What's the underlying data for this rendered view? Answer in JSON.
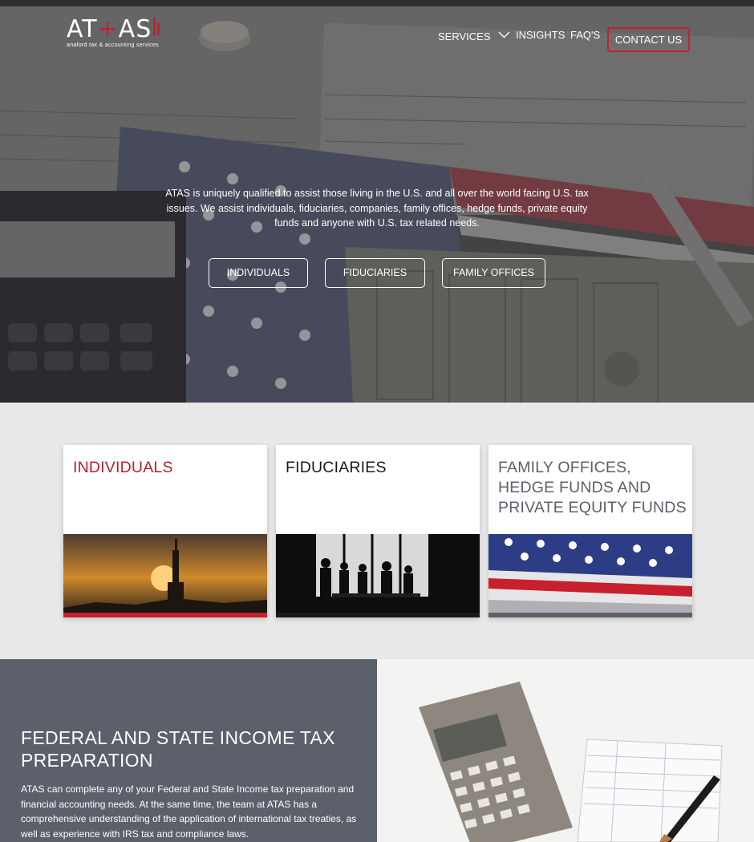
{
  "logo": {
    "main_left": "AT",
    "plus": "+",
    "main_right": "AS",
    "subtitle": "anaford tax & accounting services"
  },
  "nav": {
    "services": "SERVICES",
    "insights": "INSIGHTS",
    "faqs": "FAQ'S",
    "contact": "CONTACT US"
  },
  "hero": {
    "text": "ATAS is uniquely qualified to assist those living in the U.S. and all over the world facing U.S. tax issues. We assist individuals, fiduciaries, companies, family offices, hedge funds, private equity funds and anyone with U.S. tax related needs.",
    "buttons": [
      "INDIVIDUALS",
      "FIDUCIARIES",
      "FAMILY OFFICES"
    ]
  },
  "cards": [
    {
      "title": "INDIVIDUALS",
      "color": "#b5202c",
      "image": "statue-of-liberty-sunset"
    },
    {
      "title": "FIDUCIARIES",
      "color": "#1a1a1a",
      "image": "meeting-silhouettes"
    },
    {
      "title": "FAMILY OFFICES, HEDGE FUNDS AND PRIVATE EQUITY FUNDS",
      "color": "#5c606b",
      "image": "american-flag"
    }
  ],
  "section": {
    "title": "FEDERAL AND STATE INCOME TAX PREPARATION",
    "body": "ATAS can complete any of your Federal and State Income tax preparation and financial accounting needs. At the same time, the team at ATAS has a comprehensive understanding of the application of international tax treaties, as well as experience with IRS tax and compliance laws.",
    "image": "calculator-and-ledger"
  },
  "colors": {
    "accent": "#c4202c",
    "panel": "#5c606b",
    "page_bg": "#e8e8e8"
  }
}
